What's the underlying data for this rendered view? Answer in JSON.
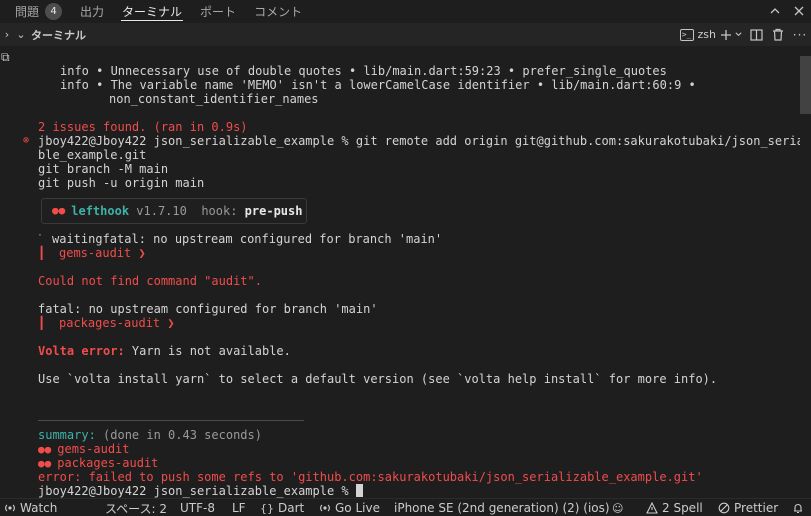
{
  "tabs": [
    {
      "label": "問題",
      "badge": "4"
    },
    {
      "label": "出力"
    },
    {
      "label": "ターミナル"
    },
    {
      "label": "ポート"
    },
    {
      "label": "コメント"
    }
  ],
  "terminal_header": {
    "title": "ターミナル",
    "shell": "zsh"
  },
  "terminal": {
    "l1": "info • Unnecessary use of double quotes • lib/main.dart:59:23 • prefer_single_quotes",
    "l2": "info • The variable name 'MEMO' isn't a lowerCamelCase identifier • lib/main.dart:60:9 •",
    "l3": "non_constant_identifier_names",
    "issues": "2 issues found. (ran in 0.9s)",
    "cmd1": "jboy422@Jboy422 json_serializable_example % git remote add origin git@github.com:sakurakotubaki/json_serializa",
    "cmd1b": "ble_example.git",
    "cmd2": "git branch -M main",
    "cmd3": "git push -u origin main",
    "hook_name": "lefthook",
    "hook_version": "v1.7.10",
    "hook_label": "hook:",
    "hook_value": "pre-push",
    "waiting": "waitingfatal: no upstream configured for branch 'main'",
    "gems_audit": "gems-audit ❯",
    "audit_error": "Could not find command \"audit\".",
    "fatal2": "fatal: no upstream configured for branch 'main'",
    "packages_audit": "packages-audit ❯",
    "volta_label": "Volta error:",
    "volta_msg": " Yarn is not available.",
    "volta_help": "Use `volta install yarn` to select a default version (see `volta help install` for more info).",
    "summary_label": "summary:",
    "summary_msg": " (done in 0.43 seconds)",
    "sum_gems": "gems-audit",
    "sum_packages": "packages-audit",
    "push_error": "error: failed to push some refs to 'github.com:sakurakotubaki/json_serializable_example.git'",
    "prompt": "jboy422@Jboy422 json_serializable_example % "
  },
  "status_bar": {
    "watch": "Watch",
    "spaces": "スペース: 2",
    "encoding": "UTF-8",
    "eol": "LF",
    "language": "Dart",
    "golive": "Go Live",
    "device": "iPhone SE (2nd generation) (2) (ios)",
    "spell": "2 Spell",
    "prettier": "Prettier"
  },
  "icons": [
    "chevron-up-icon",
    "close-icon",
    "chevron-right-icon",
    "chevron-down-icon",
    "terminal-icon",
    "plus-icon",
    "split-icon",
    "trash-icon",
    "more-icon",
    "maximize-icon",
    "warning-icon",
    "bell-icon",
    "broadcast-icon",
    "lefthook-glasses-icon"
  ],
  "colors": {
    "error": "#f14c4c",
    "success": "#3fb1a7",
    "background": "#1e1e1e"
  }
}
